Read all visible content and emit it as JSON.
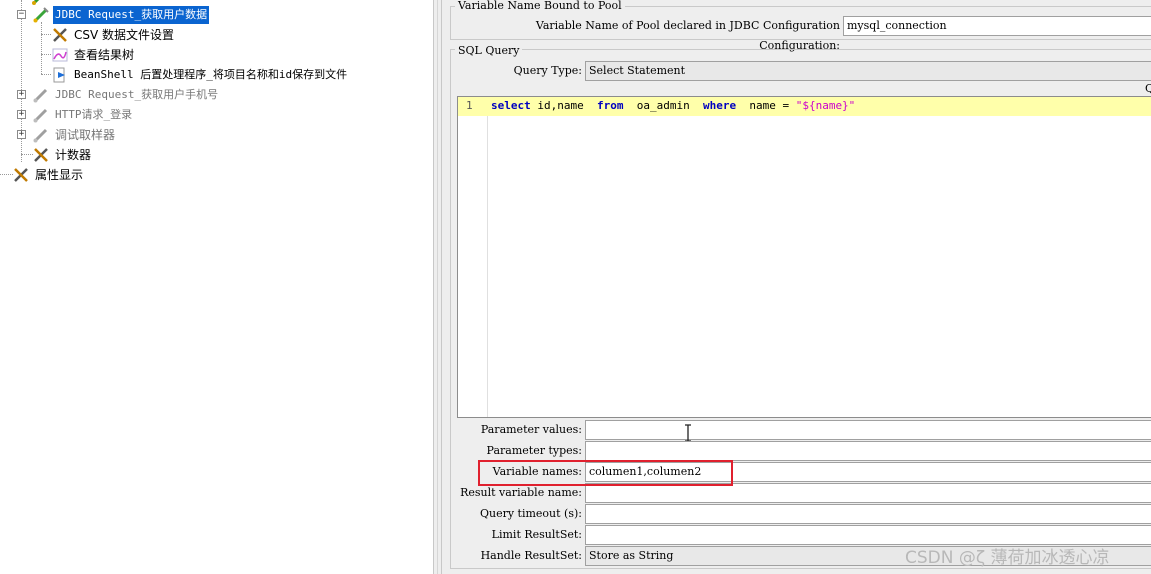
{
  "tree": {
    "items": [
      {
        "label": "JDBC Request_获取用户数据"
      },
      {
        "label": "CSV 数据文件设置"
      },
      {
        "label": "查看结果树"
      },
      {
        "label": "BeanShell 后置处理程序_将项目名称和id保存到文件"
      },
      {
        "label": "JDBC Request_获取用户手机号"
      },
      {
        "label": "HTTP请求_登录"
      },
      {
        "label": "调试取样器"
      },
      {
        "label": "计数器"
      },
      {
        "label": "属性显示"
      }
    ]
  },
  "panel": {
    "pool_section_title": "Variable Name Bound to Pool",
    "pool_label": "Variable Name of Pool declared in JDBC Configuration Configuration:",
    "pool_value": "mysql_connection",
    "sql_section_title": "SQL Query",
    "query_type_label": "Query Type:",
    "query_type_value": "Select Statement",
    "edge_glyph": "Q",
    "line_number": "1",
    "sql": {
      "kw_select": "select",
      "cols": " id,name  ",
      "kw_from": "from",
      "table": "  oa_admin  ",
      "kw_where": "where",
      "cond": "  name = ",
      "literal": "\"${name}\""
    },
    "fields": [
      {
        "label": "Parameter values:",
        "value": ""
      },
      {
        "label": "Parameter types:",
        "value": ""
      },
      {
        "label": "Variable names:",
        "value": "columen1,columen2"
      },
      {
        "label": "Result variable name:",
        "value": ""
      },
      {
        "label": "Query timeout (s):",
        "value": ""
      },
      {
        "label": "Limit ResultSet:",
        "value": ""
      },
      {
        "label": "Handle ResultSet:",
        "value": "Store as String"
      }
    ]
  },
  "watermark": "CSDN @ζ 薄荷加冰透心凉",
  "colors": {
    "selection": "#0a64d0",
    "current_line": "#ffffaa",
    "keyword": "#0000c0",
    "string": "#cc00cc",
    "highlight_box": "#e0202e"
  }
}
